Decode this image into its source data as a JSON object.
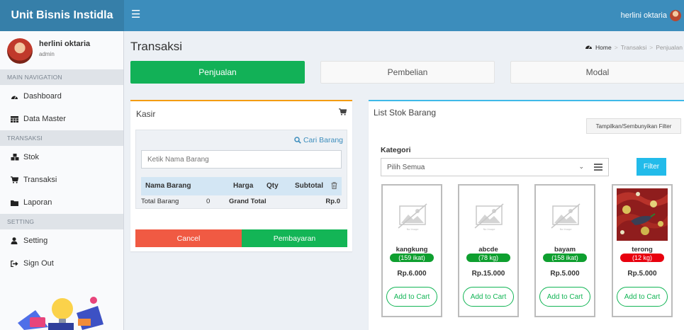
{
  "app": {
    "brand": "Unit Bisnis Instidla",
    "menu_icon": "hamburger-icon"
  },
  "topbar": {
    "user_name": "herlini oktaria"
  },
  "sidebar": {
    "user": {
      "name": "herlini oktaria",
      "role": "admin"
    },
    "sections": [
      {
        "header": "MAIN NAVIGATION",
        "items": [
          {
            "label": "Dashboard",
            "icon": "tachometer-icon"
          },
          {
            "label": "Data Master",
            "icon": "table-icon"
          }
        ]
      },
      {
        "header": "TRANSAKSI",
        "items": [
          {
            "label": "Stok",
            "icon": "cubes-icon"
          },
          {
            "label": "Transaksi",
            "icon": "cart-icon"
          },
          {
            "label": "Laporan",
            "icon": "folder-icon"
          }
        ]
      },
      {
        "header": "SETTING",
        "items": [
          {
            "label": "Setting",
            "icon": "user-icon"
          },
          {
            "label": "Sign Out",
            "icon": "sign-out-icon"
          }
        ]
      }
    ]
  },
  "page": {
    "title": "Transaksi",
    "breadcrumb": [
      "Home",
      "Transaksi",
      "Penjualan"
    ]
  },
  "tabs": [
    {
      "label": "Penjualan",
      "active": true
    },
    {
      "label": "Pembelian",
      "active": false
    },
    {
      "label": "Modal",
      "active": false
    }
  ],
  "kasir": {
    "title": "Kasir",
    "search_link": "Cari Barang",
    "search_placeholder": "Ketik Nama Barang",
    "columns": [
      "Nama Barang",
      "Harga",
      "Qty",
      "Subtotal"
    ],
    "total_label": "Total Barang",
    "total_value": "0",
    "grand_total_label": "Grand Total",
    "grand_total_value": "Rp.0",
    "cancel_label": "Cancel",
    "pay_label": "Pembayaran"
  },
  "stok": {
    "title": "List Stok Barang",
    "toggle_filter_label": "Tampilkan/Sembunyikan Filter",
    "kategori_label": "Kategori",
    "kategori_selected": "Pilih Semua",
    "filter_label": "Filter",
    "add_label": "Add to Cart",
    "no_image_text": "No Image",
    "products": [
      {
        "name": "kangkung",
        "stock": "(159 ikat)",
        "price": "Rp.6.000",
        "stock_color": "#0e9f2f",
        "image": "no-image-icon"
      },
      {
        "name": "abcde",
        "stock": "(78 kg)",
        "price": "Rp.15.000",
        "stock_color": "#0e9f2f",
        "image": "no-image-icon"
      },
      {
        "name": "bayam",
        "stock": "(158 ikat)",
        "price": "Rp.5.000",
        "stock_color": "#0e9f2f",
        "image": "no-image-icon"
      },
      {
        "name": "terong",
        "stock": "(12 kg)",
        "price": "Rp.5.000",
        "stock_color": "#e8000e",
        "image": "product-photo"
      }
    ]
  },
  "colors": {
    "primary": "#3c8dbc",
    "success": "#13b556",
    "danger": "#f05a43",
    "info": "#22bbea",
    "warning": "#f39c12"
  }
}
